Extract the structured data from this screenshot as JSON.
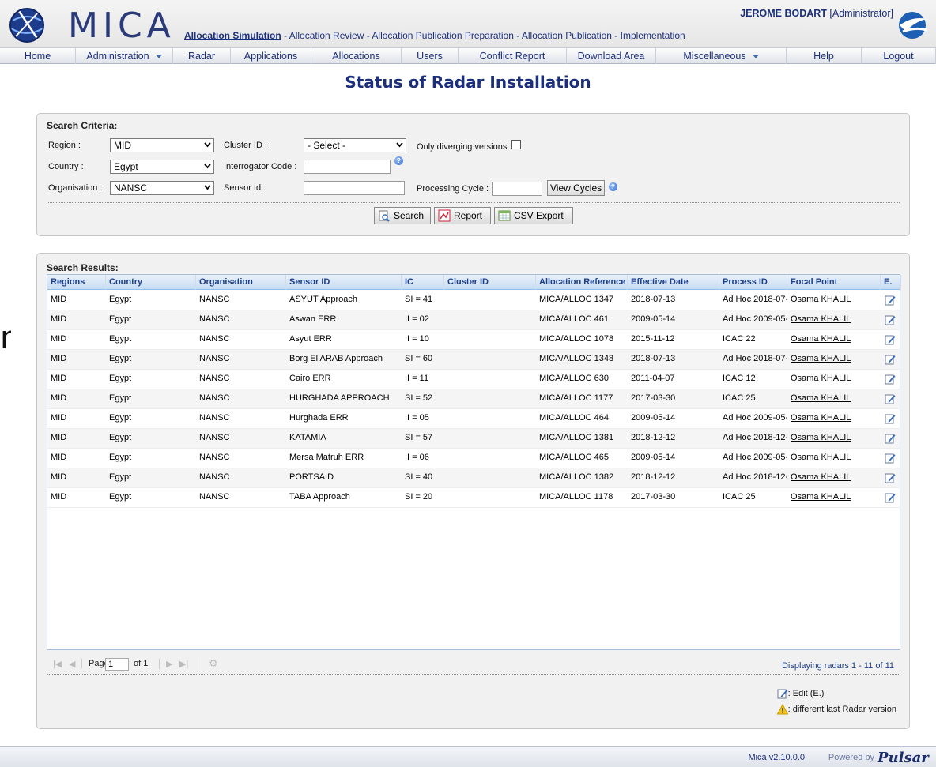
{
  "header": {
    "logo_text": "MICA",
    "phases": [
      {
        "label": "Allocation Simulation",
        "active": true
      },
      {
        "label": "Allocation Review",
        "active": false
      },
      {
        "label": "Allocation Publication Preparation",
        "active": false
      },
      {
        "label": "Allocation Publication",
        "active": false
      },
      {
        "label": "Implementation",
        "active": false
      }
    ],
    "phase_separator": " - ",
    "user_name": "JEROME BODART",
    "user_role": "[Administrator]"
  },
  "nav": {
    "items": [
      {
        "label": "Home",
        "dropdown": false
      },
      {
        "label": "Administration",
        "dropdown": true
      },
      {
        "label": "Radar",
        "dropdown": false
      },
      {
        "label": "Applications",
        "dropdown": false
      },
      {
        "label": "Allocations",
        "dropdown": false
      },
      {
        "label": "Users",
        "dropdown": false
      },
      {
        "label": "Conflict Report",
        "dropdown": false
      },
      {
        "label": "Download Area",
        "dropdown": false
      },
      {
        "label": "Miscellaneous",
        "dropdown": true
      },
      {
        "label": "Help",
        "dropdown": false
      },
      {
        "label": "Logout",
        "dropdown": false
      }
    ]
  },
  "page_title": "Status of Radar Installation",
  "criteria": {
    "title": "Search Criteria:",
    "region_label": "Region :",
    "region_value": "MID",
    "country_label": "Country :",
    "country_value": "Egypt",
    "organisation_label": "Organisation :",
    "organisation_value": "NANSC",
    "cluster_label": "Cluster ID :",
    "cluster_value": "- Select -",
    "interrogator_label": "Interrogator Code :",
    "interrogator_value": "",
    "sensor_label": "Sensor Id :",
    "sensor_value": "",
    "diverging_label": "Only diverging versions :",
    "processing_label": "Processing Cycle :",
    "processing_value": "",
    "view_cycles_label": "View Cycles",
    "search_label": "Search",
    "report_label": "Report",
    "csv_label": "CSV Export"
  },
  "results": {
    "title": "Search Results:",
    "columns": [
      "Regions",
      "Country",
      "Organisation",
      "Sensor ID",
      "IC",
      "Cluster ID",
      "Allocation Reference",
      "Effective Date",
      "Process ID",
      "Focal Point",
      "E."
    ],
    "rows": [
      [
        "MID",
        "Egypt",
        "NANSC",
        "ASYUT Approach",
        "SI = 41",
        "",
        "MICA/ALLOC 1347",
        "2018-07-13",
        "Ad Hoc 2018-07-",
        "Osama KHALIL"
      ],
      [
        "MID",
        "Egypt",
        "NANSC",
        "Aswan ERR",
        "II = 02",
        "",
        "MICA/ALLOC 461",
        "2009-05-14",
        "Ad Hoc 2009-05-",
        "Osama KHALIL"
      ],
      [
        "MID",
        "Egypt",
        "NANSC",
        "Asyut ERR",
        "II = 10",
        "",
        "MICA/ALLOC 1078",
        "2015-11-12",
        "ICAC 22",
        "Osama KHALIL"
      ],
      [
        "MID",
        "Egypt",
        "NANSC",
        "Borg El ARAB Approach",
        "SI = 60",
        "",
        "MICA/ALLOC 1348",
        "2018-07-13",
        "Ad Hoc 2018-07-",
        "Osama KHALIL"
      ],
      [
        "MID",
        "Egypt",
        "NANSC",
        "Cairo ERR",
        "II = 11",
        "",
        "MICA/ALLOC 630",
        "2011-04-07",
        "ICAC 12",
        "Osama KHALIL"
      ],
      [
        "MID",
        "Egypt",
        "NANSC",
        "HURGHADA APPROACH",
        "SI = 52",
        "",
        "MICA/ALLOC 1177",
        "2017-03-30",
        "ICAC 25",
        "Osama KHALIL"
      ],
      [
        "MID",
        "Egypt",
        "NANSC",
        "Hurghada ERR",
        "II = 05",
        "",
        "MICA/ALLOC 464",
        "2009-05-14",
        "Ad Hoc 2009-05-",
        "Osama KHALIL"
      ],
      [
        "MID",
        "Egypt",
        "NANSC",
        "KATAMIA",
        "SI = 57",
        "",
        "MICA/ALLOC 1381",
        "2018-12-12",
        "Ad Hoc 2018-12-",
        "Osama KHALIL"
      ],
      [
        "MID",
        "Egypt",
        "NANSC",
        "Mersa Matruh ERR",
        "II = 06",
        "",
        "MICA/ALLOC 465",
        "2009-05-14",
        "Ad Hoc 2009-05-",
        "Osama KHALIL"
      ],
      [
        "MID",
        "Egypt",
        "NANSC",
        "PORTSAID",
        "SI = 40",
        "",
        "MICA/ALLOC 1382",
        "2018-12-12",
        "Ad Hoc 2018-12-",
        "Osama KHALIL"
      ],
      [
        "MID",
        "Egypt",
        "NANSC",
        "TABA Approach",
        "SI = 20",
        "",
        "MICA/ALLOC 1178",
        "2017-03-30",
        "ICAC 25",
        "Osama KHALIL"
      ]
    ],
    "pager_page_label": "Page",
    "pager_page_value": "1",
    "pager_of": "of 1",
    "displaying": "Displaying radars 1 - 11 of 11"
  },
  "legend": {
    "edit": ": Edit (E.)",
    "warning": ": different last Radar version"
  },
  "footer": {
    "version": "Mica v2.10.0.0",
    "powered_by": "Powered by"
  },
  "edge_glyph": "n",
  "colors": {
    "accent": "#1c2f7a",
    "grid_header": "#c8dcf2"
  }
}
